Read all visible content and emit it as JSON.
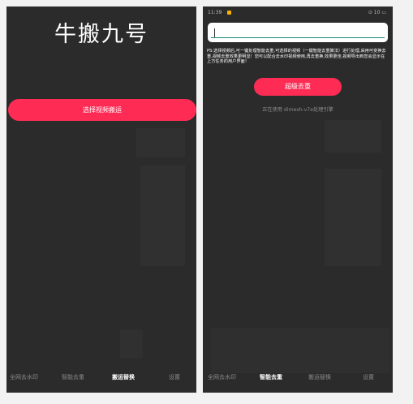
{
  "screen1": {
    "app_title": "牛搬九号",
    "select_button": "选择视频搬运",
    "tabs": [
      {
        "label": "全网去水印",
        "active": false
      },
      {
        "label": "智能去重",
        "active": false
      },
      {
        "label": "搬运替换",
        "active": true
      },
      {
        "label": "设置",
        "active": false
      }
    ]
  },
  "screen2": {
    "status": {
      "time": "11:39",
      "right": "⊙ 10 ▭"
    },
    "input": {
      "value": "",
      "placeholder": ""
    },
    "info_text": "PS:选择视频后,可一键处理智能去重,可选择的视频（一键智能去重算法）进行处理,采用可变换去重,视频去重效果更明显！您可以配合去水印视频使用,再去重换,效果更佳,视频导出到您会显示在上方任务的用户界面！",
    "dedupe_button": "超级去重",
    "using_text": "正在使用 dimesh-v7e处理引擎",
    "tabs": [
      {
        "label": "全网去水印",
        "active": false
      },
      {
        "label": "智能去重",
        "active": true
      },
      {
        "label": "搬运替换",
        "active": false
      },
      {
        "label": "设置",
        "active": false
      }
    ]
  },
  "colors": {
    "accent": "#fe2c55",
    "background": "#2b2b2b",
    "page": "#f2f2f2"
  }
}
